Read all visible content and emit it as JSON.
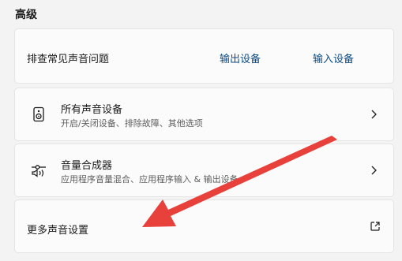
{
  "section": {
    "title": "高级"
  },
  "troubleshoot": {
    "label": "排查常见声音问题",
    "output_link": "输出设备",
    "input_link": "输入设备"
  },
  "all_devices": {
    "title": "所有声音设备",
    "subtitle": "开启/关闭设备、排除故障、其他选项",
    "icon": "speaker-icon"
  },
  "mixer": {
    "title": "音量合成器",
    "subtitle": "应用程序音量混合、应用程序输入 & 输出设备",
    "icon": "volume-mixer-icon"
  },
  "more_settings": {
    "label": "更多声音设置",
    "icon": "open-external-icon"
  },
  "colors": {
    "link": "#0a4a83",
    "annotation_arrow": "#e8403a"
  }
}
